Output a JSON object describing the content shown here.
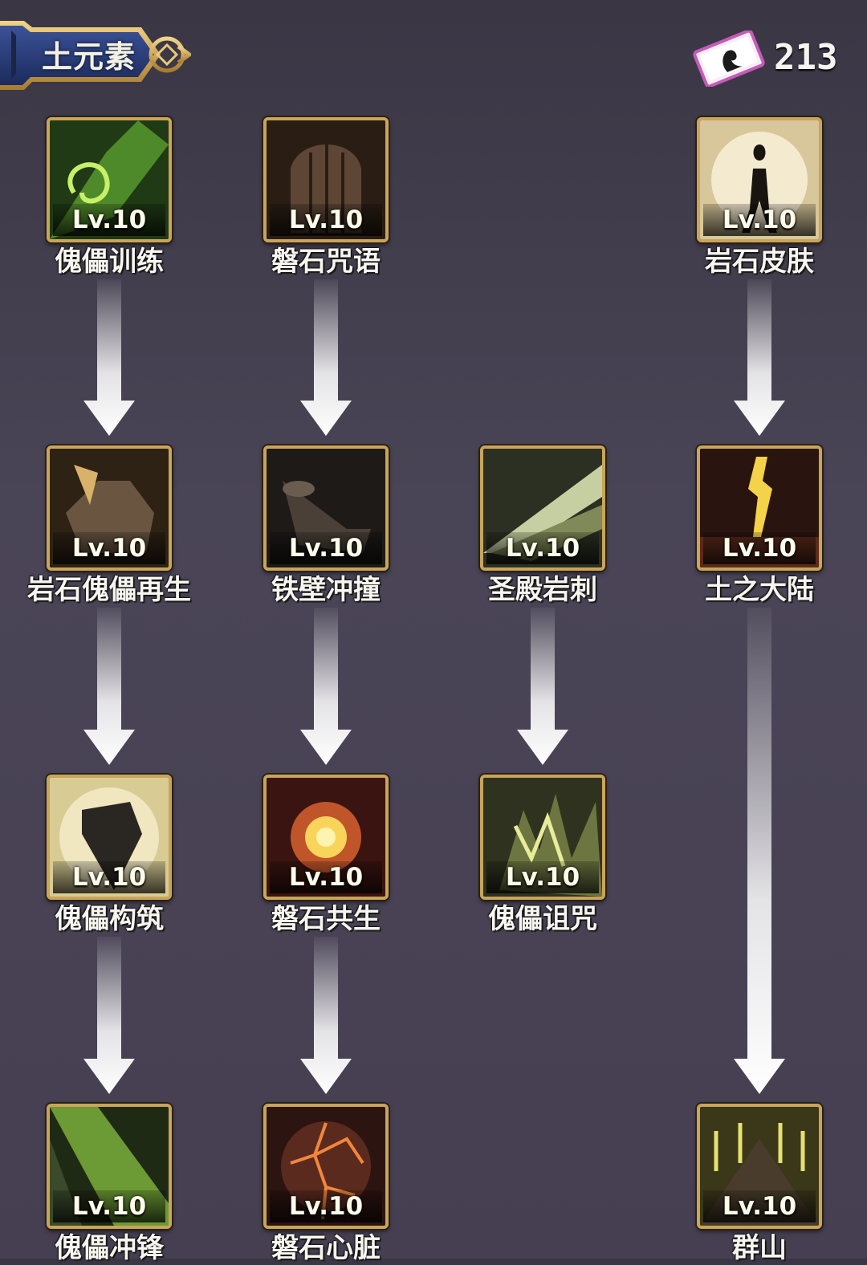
{
  "header": {
    "title": "土元素"
  },
  "currency": {
    "value": "213",
    "icon": "skill-scroll-icon"
  },
  "skills": [
    {
      "id": "golem-training",
      "name": "傀儡训练",
      "level": "Lv.10",
      "theme": "green"
    },
    {
      "id": "boulder-chant",
      "name": "磐石咒语",
      "level": "Lv.10",
      "theme": "brown"
    },
    {
      "id": "rock-skin",
      "name": "岩石皮肤",
      "level": "Lv.10",
      "theme": "gold"
    },
    {
      "id": "rock-golem-regen",
      "name": "岩石傀儡再生",
      "level": "Lv.10",
      "theme": "amber"
    },
    {
      "id": "iron-wall-charge",
      "name": "铁壁冲撞",
      "level": "Lv.10",
      "theme": "dark"
    },
    {
      "id": "temple-rock-spike",
      "name": "圣殿岩刺",
      "level": "Lv.10",
      "theme": "olive"
    },
    {
      "id": "earth-continent",
      "name": "土之大陆",
      "level": "Lv.10",
      "theme": "fire"
    },
    {
      "id": "golem-construct",
      "name": "傀儡构筑",
      "level": "Lv.10",
      "theme": "tan"
    },
    {
      "id": "boulder-symbiosis",
      "name": "磐石共生",
      "level": "Lv.10",
      "theme": "burst"
    },
    {
      "id": "golem-curse",
      "name": "傀儡诅咒",
      "level": "Lv.10",
      "theme": "olive2"
    },
    {
      "id": "golem-charge",
      "name": "傀儡冲锋",
      "level": "Lv.10",
      "theme": "green2"
    },
    {
      "id": "boulder-heart",
      "name": "磐石心脏",
      "level": "Lv.10",
      "theme": "lava"
    },
    {
      "id": "mountains",
      "name": "群山",
      "level": "Lv.10",
      "theme": "yellow"
    }
  ],
  "colors": {
    "frame": "#c9a45a",
    "banner": "#2d3f7a",
    "background": "#463f52"
  }
}
